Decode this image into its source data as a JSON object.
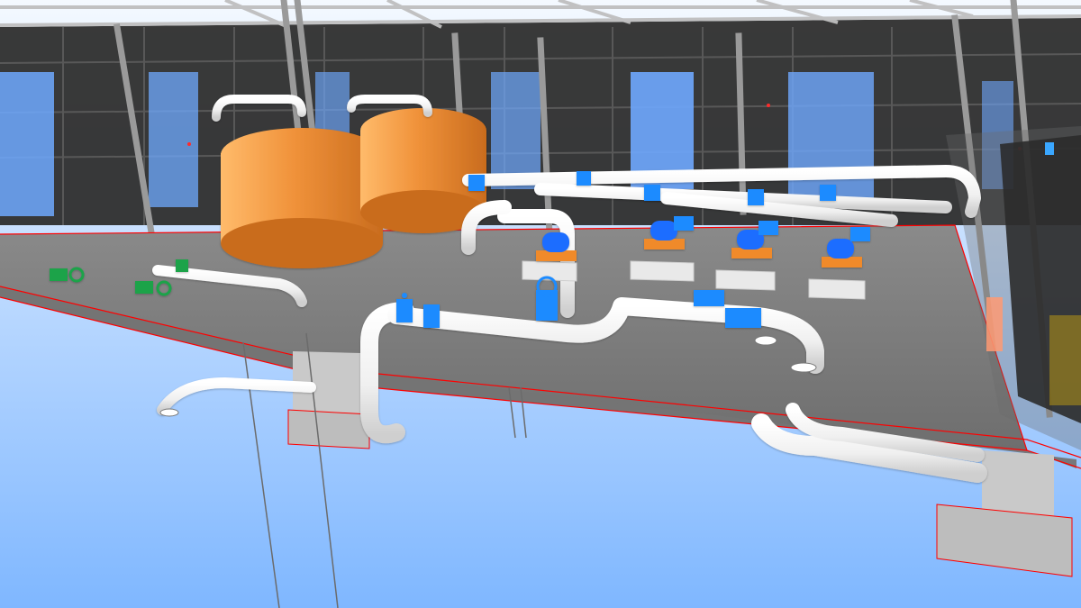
{
  "viewport": {
    "background_sky_top": "#f4f9ff",
    "background_sky_bottom": "#7fb7ff"
  },
  "colors": {
    "floor": "#7f7f7f",
    "floor_edge": "#ff0000",
    "wall_dark": "#3a3a3a",
    "frame": "#9a9a9a",
    "window_blue": "#6fa9ff",
    "tank_orange": "#f0923a",
    "pipe_white": "#f7f7f7",
    "valve_blue": "#1f8bff",
    "valve_green": "#1aa34a",
    "pump_orange": "#f08a2a",
    "pump_blue": "#1f6dff",
    "pad_light": "#e8e8e8"
  },
  "icons": {
    "valve": "blue-gate-valve-icon",
    "green_valve": "green-valve-icon",
    "pump": "pump-icon",
    "tank": "pressure-tank-icon"
  }
}
